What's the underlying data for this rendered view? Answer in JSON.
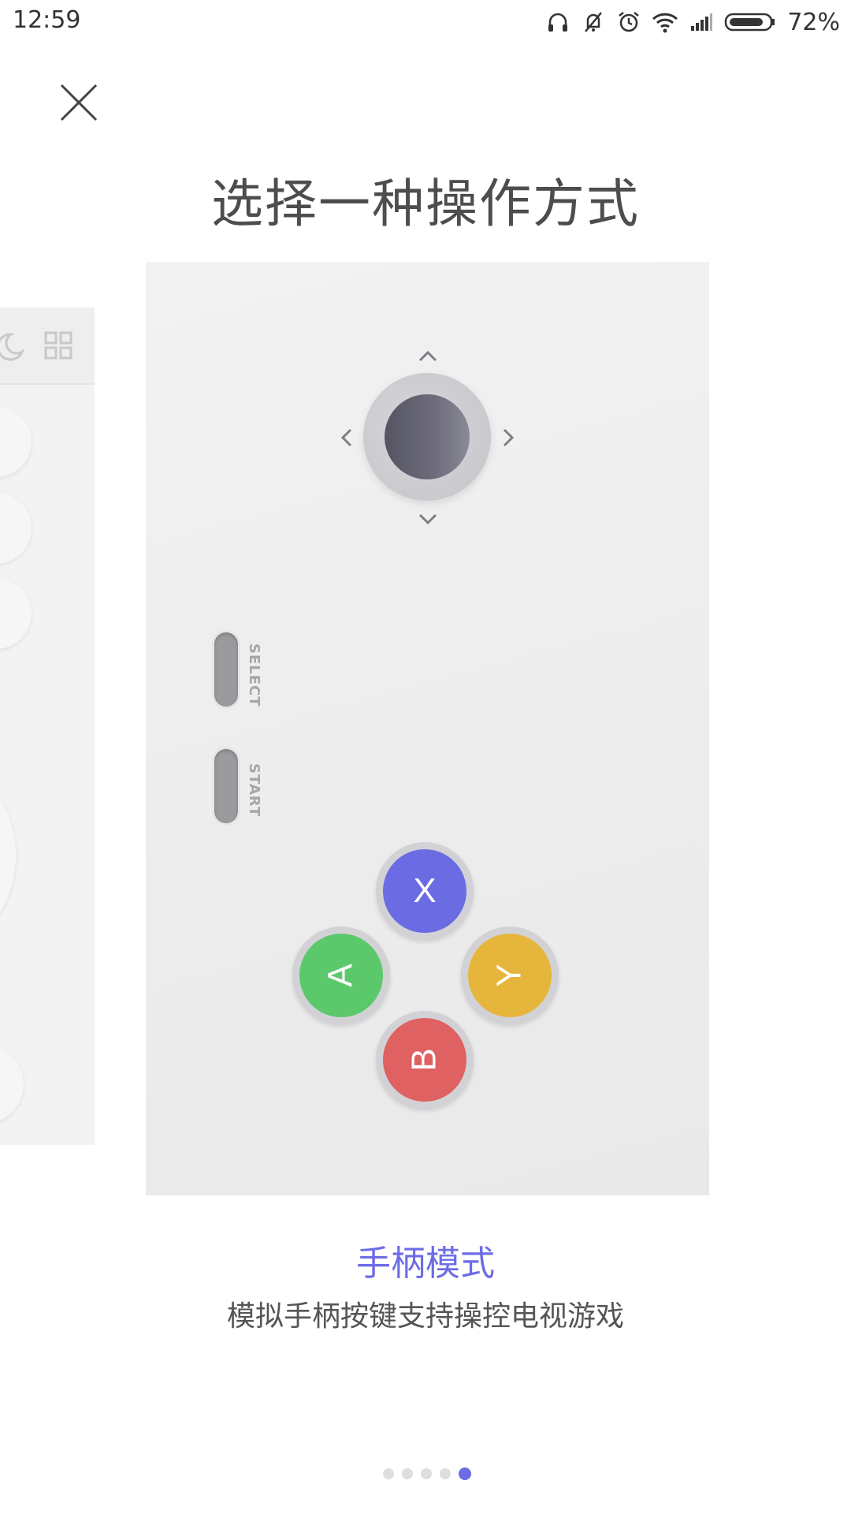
{
  "status_bar": {
    "time": "12:59",
    "battery": "72%",
    "icons": [
      "headphones-icon",
      "mute-vibrate-icon",
      "alarm-icon",
      "wifi-icon",
      "signal-icon",
      "battery-icon"
    ]
  },
  "page": {
    "title": "选择一种操作方式"
  },
  "controller": {
    "select_label": "SELECT",
    "start_label": "START",
    "buttons": {
      "x": {
        "label": "X",
        "color": "#6b6be3"
      },
      "a": {
        "label": "A",
        "color": "#5cc86c"
      },
      "y": {
        "label": "Y",
        "color": "#e6b53c"
      },
      "b": {
        "label": "B",
        "color": "#e06161"
      }
    },
    "joystick_color": "#5e5d6b"
  },
  "mode": {
    "name": "手柄模式",
    "description": "模拟手柄按键支持操控电视游戏"
  },
  "pager": {
    "total": 5,
    "active_index": 4,
    "accent": "#6c6ce6"
  }
}
